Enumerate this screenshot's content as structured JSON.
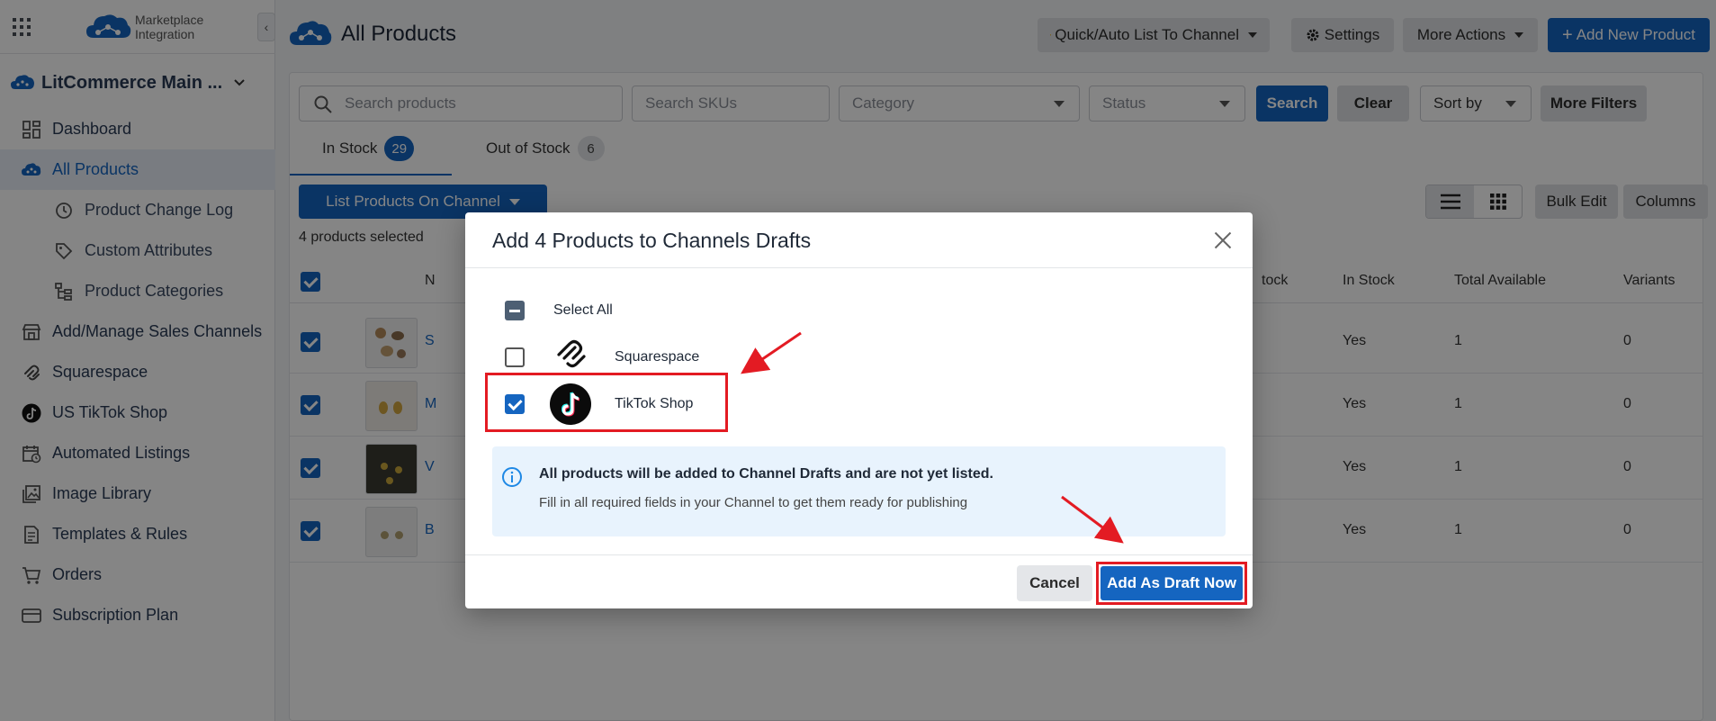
{
  "sidebar": {
    "brand_line1": "Marketplace",
    "brand_line2": "Integration",
    "collapse_glyph": "‹",
    "store_name": "LitCommerce Main ...",
    "items": [
      {
        "label": "Dashboard",
        "icon": "dashboard-icon"
      },
      {
        "label": "All Products",
        "icon": "products-cloud-icon"
      },
      {
        "label": "Product Change Log",
        "icon": "history-icon"
      },
      {
        "label": "Custom Attributes",
        "icon": "tag-icon"
      },
      {
        "label": "Product Categories",
        "icon": "tree-icon"
      },
      {
        "label": "Add/Manage Sales Channels",
        "icon": "store-icon"
      },
      {
        "label": "Squarespace",
        "icon": "squarespace-icon"
      },
      {
        "label": "US TikTok Shop",
        "icon": "tiktok-icon"
      },
      {
        "label": "Automated Listings",
        "icon": "calendar-clock-icon"
      },
      {
        "label": "Image Library",
        "icon": "image-icon"
      },
      {
        "label": "Templates & Rules",
        "icon": "document-icon"
      },
      {
        "label": "Orders",
        "icon": "cart-icon"
      },
      {
        "label": "Subscription Plan",
        "icon": "card-icon"
      }
    ]
  },
  "header": {
    "title": "All Products",
    "quick_list": "Quick/Auto List To Channel",
    "settings": "Settings",
    "more_actions": "More Actions",
    "add_new": "Add New Product"
  },
  "filters": {
    "search_placeholder": "Search products",
    "sku_placeholder": "Search SKUs",
    "category": "Category",
    "status": "Status",
    "search": "Search",
    "clear": "Clear",
    "sort_by": "Sort by",
    "more_filters": "More Filters"
  },
  "tabs": [
    {
      "label": "In Stock",
      "count": "29"
    },
    {
      "label": "Out of Stock",
      "count": "6"
    }
  ],
  "toolbar": {
    "list_on_channel": "List Products On Channel",
    "selected_count": "4 products selected",
    "bulk_edit": "Bulk Edit",
    "columns": "Columns"
  },
  "table": {
    "headers": {
      "name": "N",
      "stock": "tock",
      "in_stock": "In Stock",
      "total_available": "Total Available",
      "variants": "Variants"
    },
    "rows": [
      {
        "name_initial": "S",
        "in_stock": "Yes",
        "total_available": "1",
        "variants": "0"
      },
      {
        "name_initial": "M",
        "in_stock": "Yes",
        "total_available": "1",
        "variants": "0"
      },
      {
        "name_initial": "V",
        "in_stock": "Yes",
        "total_available": "1",
        "variants": "0"
      },
      {
        "name_initial": "B",
        "in_stock": "Yes",
        "total_available": "1",
        "variants": "0"
      }
    ]
  },
  "modal": {
    "title": "Add 4 Products to Channels Drafts",
    "select_all": "Select All",
    "channels": [
      {
        "label": "Squarespace",
        "checked": false,
        "icon": "squarespace-logo-icon"
      },
      {
        "label": "TikTok Shop",
        "checked": true,
        "icon": "tiktok-logo-icon"
      }
    ],
    "info_title": "All products will be added to Channel Drafts and are not yet listed.",
    "info_sub": "Fill in all required fields in your Channel to get them ready for publishing",
    "cancel": "Cancel",
    "add_draft": "Add As Draft Now"
  },
  "colors": {
    "primary": "#1565c0",
    "annotation_red": "#e31b23",
    "info_bg": "#e8f3fd"
  }
}
